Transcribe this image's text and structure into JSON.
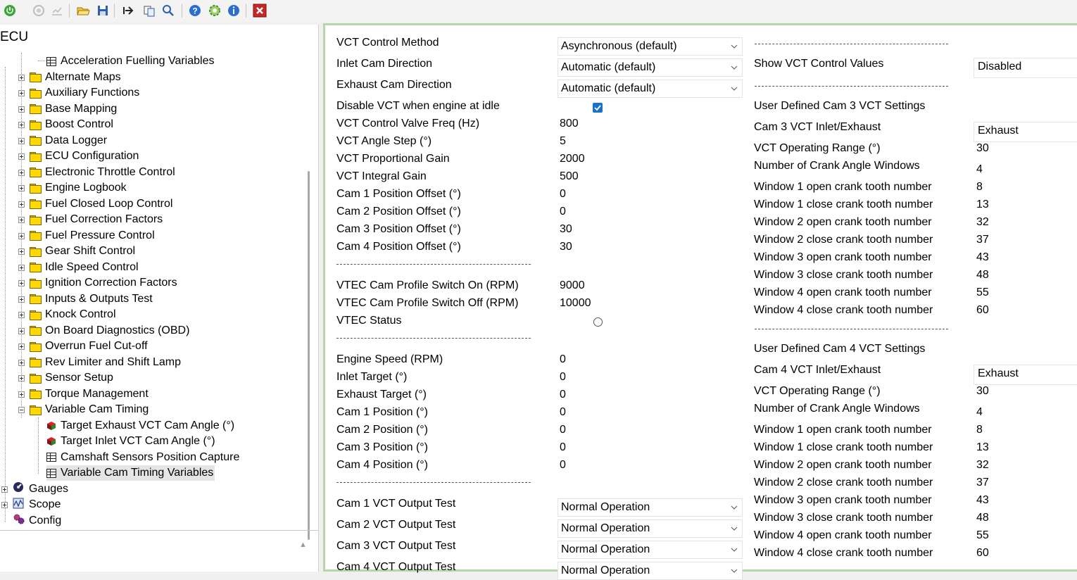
{
  "toolbar": {
    "icons": [
      "power-icon",
      "disconnect-icon",
      "chart-icon",
      "open-folder-icon",
      "save-icon",
      "export-icon",
      "copy-icon",
      "search-icon",
      "help-icon",
      "settings-icon",
      "info-icon",
      "close-icon"
    ]
  },
  "tree": {
    "header": "ECU",
    "items": [
      {
        "label": "Acceleration Fuelling Variables"
      },
      {
        "label": "Alternate Maps"
      },
      {
        "label": "Auxiliary Functions"
      },
      {
        "label": "Base Mapping"
      },
      {
        "label": "Boost Control"
      },
      {
        "label": "Data Logger"
      },
      {
        "label": "ECU Configuration"
      },
      {
        "label": "Electronic Throttle Control"
      },
      {
        "label": "Engine Logbook"
      },
      {
        "label": "Fuel Closed Loop Control"
      },
      {
        "label": "Fuel Correction Factors"
      },
      {
        "label": "Fuel Pressure Control"
      },
      {
        "label": "Gear Shift Control"
      },
      {
        "label": "Idle Speed Control"
      },
      {
        "label": "Ignition Correction Factors"
      },
      {
        "label": "Inputs & Outputs Test"
      },
      {
        "label": "Knock Control"
      },
      {
        "label": "On Board Diagnostics (OBD)"
      },
      {
        "label": "Overrun Fuel Cut-off"
      },
      {
        "label": "Rev Limiter and Shift Lamp"
      },
      {
        "label": "Sensor Setup"
      },
      {
        "label": "Torque Management"
      },
      {
        "label": "Variable Cam Timing"
      },
      {
        "label": "Target Exhaust VCT Cam Angle (°)"
      },
      {
        "label": "Target Inlet VCT Cam Angle (°)"
      },
      {
        "label": "Camshaft Sensors Position Capture"
      },
      {
        "label": "Variable Cam Timing Variables"
      },
      {
        "label": "Gauges"
      },
      {
        "label": "Scope"
      },
      {
        "label": "Config"
      }
    ]
  },
  "left": {
    "vct_control_method": {
      "label": "VCT Control Method",
      "value": "Asynchronous (default)"
    },
    "inlet_cam_direction": {
      "label": "Inlet Cam Direction",
      "value": "Automatic (default)"
    },
    "exhaust_cam_direction": {
      "label": "Exhaust Cam Direction",
      "value": "Automatic (default)"
    },
    "disable_vct_idle": {
      "label": "Disable VCT when engine at idle",
      "checked": true
    },
    "params": [
      {
        "label": "VCT Control Valve Freq (Hz)",
        "value": "800"
      },
      {
        "label": "VCT Angle Step (°)",
        "value": "5"
      },
      {
        "label": "VCT Proportional Gain",
        "value": "2000"
      },
      {
        "label": "VCT Integral Gain",
        "value": "500"
      },
      {
        "label": "Cam 1 Position Offset (°)",
        "value": "0"
      },
      {
        "label": "Cam 2 Position Offset (°)",
        "value": "0"
      },
      {
        "label": "Cam 3 Position Offset (°)",
        "value": "30"
      },
      {
        "label": "Cam 4 Position Offset (°)",
        "value": "30"
      }
    ],
    "separator": "--------------------------------------------------------------------",
    "vtec": [
      {
        "label": "VTEC Cam Profile Switch On (RPM)",
        "value": "9000"
      },
      {
        "label": "VTEC Cam Profile Switch Off (RPM)",
        "value": "10000"
      }
    ],
    "vtec_status": {
      "label": "VTEC Status"
    },
    "live": [
      {
        "label": "Engine Speed (RPM)",
        "value": "0"
      },
      {
        "label": "Inlet Target (°)",
        "value": "0"
      },
      {
        "label": "Exhaust Target (°)",
        "value": "0"
      },
      {
        "label": "Cam 1 Position (°)",
        "value": "0"
      },
      {
        "label": "Cam 2 Position (°)",
        "value": "0"
      },
      {
        "label": "Cam 3 Position (°)",
        "value": "0"
      },
      {
        "label": "Cam 4 Position (°)",
        "value": "0"
      }
    ],
    "output_tests": [
      {
        "label": "Cam 1 VCT Output Test",
        "value": "Normal Operation"
      },
      {
        "label": "Cam 2 VCT Output Test",
        "value": "Normal Operation"
      },
      {
        "label": "Cam 3 VCT Output Test",
        "value": "Normal Operation"
      },
      {
        "label": "Cam 4 VCT Output Test",
        "value": "Normal Operation"
      }
    ]
  },
  "right": {
    "separator": "-------------------------------------------------------------------",
    "show_vct": {
      "label": "Show VCT Control Values",
      "value": "Disabled"
    },
    "cam3": {
      "title": "User Defined Cam 3 VCT Settings",
      "inlet_exhaust": {
        "label": "Cam 3 VCT Inlet/Exhaust",
        "value": "Exhaust"
      },
      "operating_range": {
        "label": "VCT Operating Range (°)",
        "value": "30"
      },
      "num_windows": {
        "label": "Number of Crank Angle Windows",
        "value": "4"
      },
      "windows": [
        {
          "label": "Window 1 open crank tooth number",
          "value": "8"
        },
        {
          "label": "Window 1 close crank tooth number",
          "value": "13"
        },
        {
          "label": "Window 2 open crank tooth number",
          "value": "32"
        },
        {
          "label": "Window 2 close crank tooth number",
          "value": "37"
        },
        {
          "label": "Window 3 open crank tooth number",
          "value": "43"
        },
        {
          "label": "Window 3 close crank tooth number",
          "value": "48"
        },
        {
          "label": "Window 4 open crank tooth number",
          "value": "55"
        },
        {
          "label": "Window 4 close crank tooth number",
          "value": "60"
        }
      ]
    },
    "cam4": {
      "title": "User Defined Cam 4 VCT Settings",
      "inlet_exhaust": {
        "label": "Cam 4 VCT Inlet/Exhaust",
        "value": "Exhaust"
      },
      "operating_range": {
        "label": "VCT Operating Range (°)",
        "value": "30"
      },
      "num_windows": {
        "label": "Number of Crank Angle Windows",
        "value": "4"
      },
      "windows": [
        {
          "label": "Window 1 open crank tooth number",
          "value": "8"
        },
        {
          "label": "Window 1 close crank tooth number",
          "value": "13"
        },
        {
          "label": "Window 2 open crank tooth number",
          "value": "32"
        },
        {
          "label": "Window 2 close crank tooth number",
          "value": "37"
        },
        {
          "label": "Window 3 open crank tooth number",
          "value": "43"
        },
        {
          "label": "Window 3 close crank tooth number",
          "value": "48"
        },
        {
          "label": "Window 4 open crank tooth number",
          "value": "55"
        },
        {
          "label": "Window 4 close crank tooth number",
          "value": "60"
        }
      ]
    }
  }
}
